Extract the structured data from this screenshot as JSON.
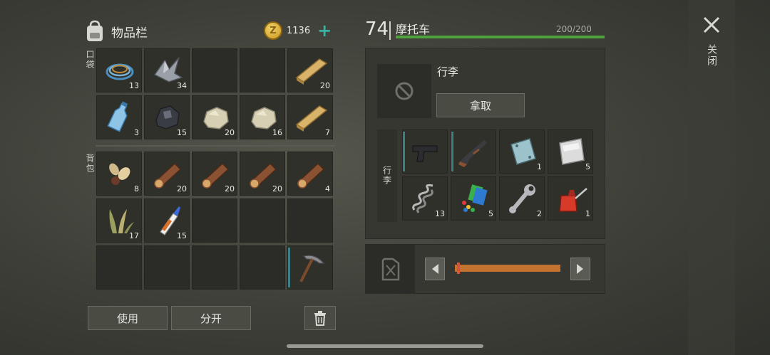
{
  "inventory": {
    "title": "物品栏",
    "coins": "1136",
    "coin_symbol": "Z",
    "pocket_label": "口袋",
    "backpack_label": "背包",
    "pockets": [
      {
        "item": "cable-coil",
        "count": "13"
      },
      {
        "item": "metal-scrap",
        "count": "34"
      },
      {
        "item": "",
        "count": ""
      },
      {
        "item": "",
        "count": ""
      },
      {
        "item": "wood-plank",
        "count": "20"
      },
      {
        "item": "water-bottle",
        "count": "3"
      },
      {
        "item": "coal-ore",
        "count": "15"
      },
      {
        "item": "stone",
        "count": "20"
      },
      {
        "item": "stone",
        "count": "16"
      },
      {
        "item": "wood-plank",
        "count": "7"
      }
    ],
    "backpack": [
      {
        "item": "seeds",
        "count": "8"
      },
      {
        "item": "log",
        "count": "20"
      },
      {
        "item": "log",
        "count": "20"
      },
      {
        "item": "log",
        "count": "20"
      },
      {
        "item": "log",
        "count": "4"
      },
      {
        "item": "plant-fiber",
        "count": "17"
      },
      {
        "item": "glue",
        "count": "15"
      },
      {
        "item": "",
        "count": ""
      },
      {
        "item": "",
        "count": ""
      },
      {
        "item": "",
        "count": ""
      },
      {
        "item": "",
        "count": ""
      },
      {
        "item": "",
        "count": ""
      },
      {
        "item": "",
        "count": ""
      },
      {
        "item": "",
        "count": ""
      },
      {
        "item": "pickaxe",
        "count": ""
      }
    ],
    "use_label": "使用",
    "split_label": "分开"
  },
  "vehicle": {
    "level": "74",
    "name": "摩托车",
    "hp_text": "200/200",
    "hp_fraction": 1.0,
    "trunk_label": "行李",
    "take_label": "拿取",
    "trunk_side_label": "行李",
    "trunk": [
      {
        "item": "pistol",
        "count": ""
      },
      {
        "item": "shotgun",
        "count": ""
      },
      {
        "item": "steel-plate",
        "count": "1"
      },
      {
        "item": "aluminum-plate",
        "count": "5"
      },
      {
        "item": "spring",
        "count": "13"
      },
      {
        "item": "paint-pieces",
        "count": "5"
      },
      {
        "item": "wrench",
        "count": "2"
      },
      {
        "item": "oil-can",
        "count": "1"
      }
    ],
    "fuel_fraction": 0.02
  },
  "close_label": "关闭",
  "colors": {
    "accent": "#3fb0a0",
    "hp": "#4fa33d",
    "fuel": "#c4722f",
    "equipped": "#3d7f85"
  }
}
